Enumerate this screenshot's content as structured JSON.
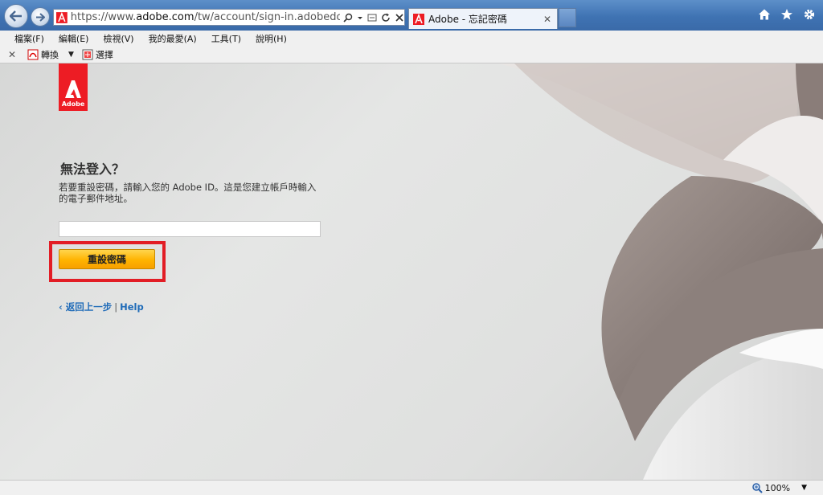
{
  "browser": {
    "url_prefix": "https://www.",
    "url_domain": "adobe.com",
    "url_path": "/tw/account/sign-in.adobedotcom.htm",
    "tab_title": "Adobe - 忘記密碼",
    "tab_close": "✕"
  },
  "menu": [
    "檔案(F)",
    "編輯(E)",
    "檢視(V)",
    "我的最愛(A)",
    "工具(T)",
    "說明(H)"
  ],
  "commandbar": {
    "close": "✕",
    "convert_label": "轉換",
    "dropdown": "▼",
    "select_label": "選擇"
  },
  "page": {
    "logo_text": "Adobe",
    "heading": "無法登入？",
    "description": "若要重設密碼，請輸入您的 Adobe ID。這是您建立帳戶時輸入的電子郵件地址。",
    "email_value": "",
    "reset_button": "重設密碼",
    "back_link": "‹ 返回上一步",
    "separator": "|",
    "help_link": "Help"
  },
  "statusbar": {
    "zoom": "100%",
    "zoom_drop": "▼"
  },
  "colors": {
    "adobe_red": "#ed1c24",
    "button_orange": "#ffb300",
    "highlight_red": "#e21d25",
    "link_blue": "#1f6bb8"
  }
}
